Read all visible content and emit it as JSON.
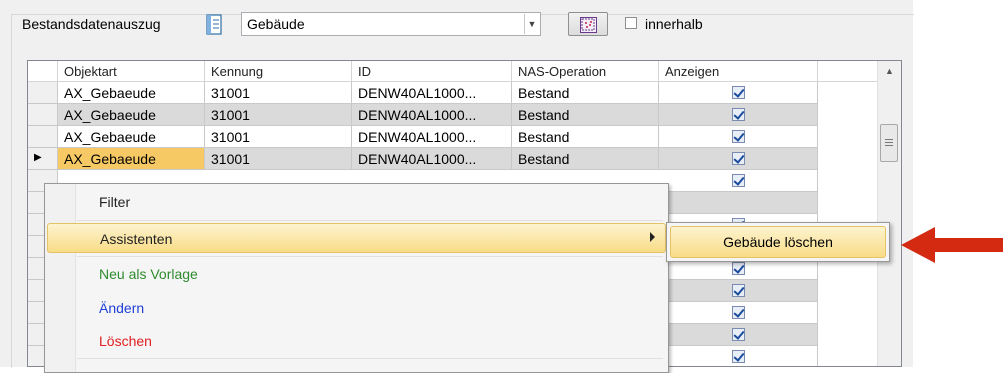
{
  "toolbar": {
    "label": "Bestandsdatenauszug",
    "combo_value": "Gebäude",
    "innerhalb_label": "innerhalb",
    "innerhalb_checked": false
  },
  "grid": {
    "columns": [
      "Objektart",
      "Kennung",
      "ID",
      "NAS-Operation",
      "Anzeigen"
    ],
    "rows": [
      {
        "objektart": "AX_Gebaeude",
        "kennung": "31001",
        "id": "DENW40AL1000...",
        "nas": "Bestand",
        "anzeigen": true
      },
      {
        "objektart": "AX_Gebaeude",
        "kennung": "31001",
        "id": "DENW40AL1000...",
        "nas": "Bestand",
        "anzeigen": true
      },
      {
        "objektart": "AX_Gebaeude",
        "kennung": "31001",
        "id": "DENW40AL1000...",
        "nas": "Bestand",
        "anzeigen": true
      },
      {
        "objektart": "AX_Gebaeude",
        "kennung": "31001",
        "id": "DENW40AL1000...",
        "nas": "Bestand",
        "anzeigen": true,
        "current": true
      }
    ],
    "current_row_marker": "▶"
  },
  "context_menu": {
    "items": [
      {
        "label": "Filter",
        "color": "#222222"
      },
      {
        "label": "Assistenten",
        "color": "#222222",
        "has_submenu": true,
        "highlighted": true
      },
      {
        "label": "Neu als Vorlage",
        "color": "#2e8b2e"
      },
      {
        "label": "Ändern",
        "color": "#1f3fd6"
      },
      {
        "label": "Löschen",
        "color": "#e02020"
      }
    ],
    "submenu": {
      "items": [
        {
          "label": "Gebäude löschen",
          "highlighted": true
        }
      ]
    }
  },
  "colors": {
    "annotation_arrow": "#d42a12",
    "highlight": "#f8dc86",
    "alt_row": "#dadada"
  }
}
